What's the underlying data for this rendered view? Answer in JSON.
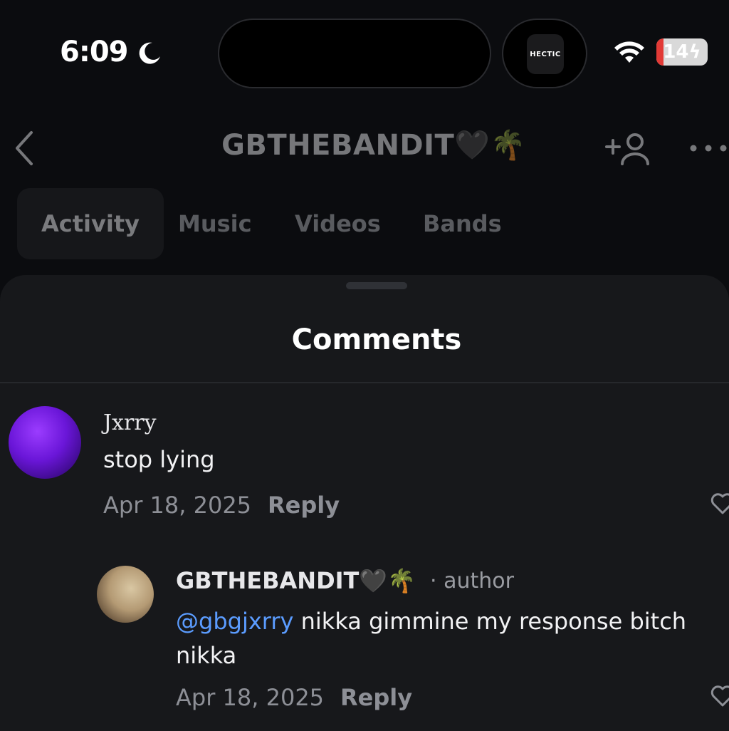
{
  "status_bar": {
    "time": "6:09",
    "battery": "14",
    "battery_level_percent": 14,
    "island_app_label": "HECTIC"
  },
  "header": {
    "title": "GBTHEBANDIT🖤🌴"
  },
  "tabs": [
    {
      "label": "Activity",
      "active": true
    },
    {
      "label": "Music",
      "active": false
    },
    {
      "label": "Videos",
      "active": false
    },
    {
      "label": "Bands",
      "active": false
    }
  ],
  "comments_sheet": {
    "title": "Comments",
    "comments": [
      {
        "username": "Jxrry",
        "text": "stop lying",
        "date": "Apr 18, 2025",
        "reply_label": "Reply"
      },
      {
        "username": "GBTHEBANDIT🖤🌴",
        "author_tag": "· author",
        "mention": "@gbgjxrry",
        "text": " nikka gimmine my response bitch nikka",
        "date": "Apr 18, 2025",
        "reply_label": "Reply"
      }
    ]
  },
  "colors": {
    "background": "#0b0c0f",
    "sheet": "#17181b",
    "mention": "#5b9cff",
    "battery_low": "#e23a36"
  }
}
